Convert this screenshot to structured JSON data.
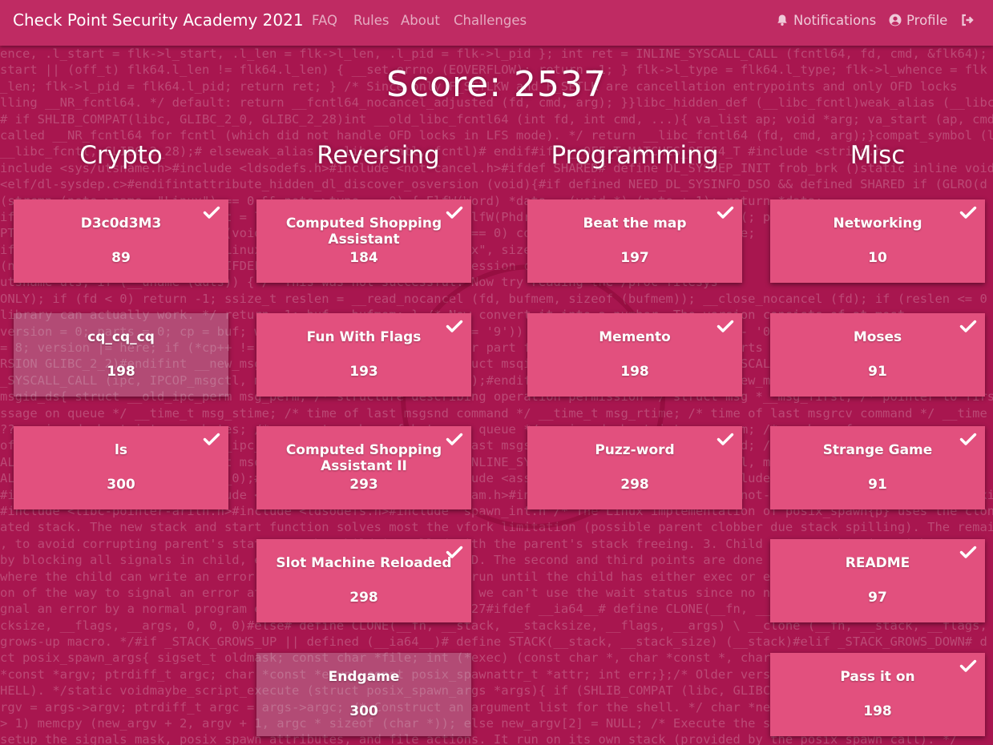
{
  "navbar": {
    "brand": "Check Point Security Academy 2021",
    "links": [
      "FAQ",
      "Rules",
      "About",
      "Challenges"
    ],
    "notifications_label": "Notifications",
    "profile_label": "Profile"
  },
  "score_text": "Score: 2537",
  "categories": [
    "Crypto",
    "Reversing",
    "Programming",
    "Misc"
  ],
  "challenges": {
    "crypto": [
      {
        "name": "D3c0d3M3",
        "points": "89",
        "solved": true
      },
      {
        "name": "cq_cq_cq",
        "points": "198",
        "solved": false
      },
      {
        "name": "ls",
        "points": "300",
        "solved": true
      }
    ],
    "reversing": [
      {
        "name": "Computed Shopping Assistant",
        "points": "184",
        "solved": true
      },
      {
        "name": "Fun With Flags",
        "points": "193",
        "solved": true
      },
      {
        "name": "Computed Shopping Assistant II",
        "points": "293",
        "solved": true
      },
      {
        "name": "Slot Machine Reloaded",
        "points": "298",
        "solved": true
      },
      {
        "name": "Endgame",
        "points": "300",
        "solved": false
      }
    ],
    "programming": [
      {
        "name": "Beat the map",
        "points": "197",
        "solved": true
      },
      {
        "name": "Memento",
        "points": "198",
        "solved": true
      },
      {
        "name": "Puzz-word",
        "points": "298",
        "solved": true
      }
    ],
    "misc": [
      {
        "name": "Networking",
        "points": "10",
        "solved": true
      },
      {
        "name": "Moses",
        "points": "91",
        "solved": true
      },
      {
        "name": "Strange Game",
        "points": "91",
        "solved": true
      },
      {
        "name": "README",
        "points": "97",
        "solved": true
      },
      {
        "name": "Pass it on",
        "points": "198",
        "solved": true
      }
    ]
  },
  "background_code": [
    "ence, .l_start = flk->l_start, .l_len = flk->l_len, .l_pid = flk->l_pid }; int ret = INLINE_SYSCALL_CALL (fcntl64, fd, cmd, &flk64);",
    "start || (off_t) flk64.l_len != flk64.l_len) { __set_errno (EOVERFLOW); return -1; } flk->l_type = flk64.l_type; flk->l_whence = flk",
    "_len; flk->l_pid = flk64.l_pid; return ret; } /* Since only F_SETLKW and F_SETLK are cancellation entrypoints and only OFD locks",
    "lling __NR_fcntl64. */ default: return __fcntl64_nocancel_adjusted (fd, cmd, arg); }}libc_hidden_def (__libc_fcntl)weak_alias (__libc",
    "# if SHLIB_COMPAT(libc, GLIBC_2_0, GLIBC_2_28)int __old_libc_fcntl64 (int fd, int cmd, ...){ va_list ap; void *arg; va_start (ap, cmd",
    "called __NR_fcntl64 for fcntl (which did not handle OFD locks in LFS mode). */ return __libc_fcntl64 (fd, cmd, arg);}compat_symbol (l",
    "__libc_fcntl, GLIBC_2_28);# elseweak_alias (__libc_fcntl, fcntl)# endif#if !__OFF_T_MATCHES_OFF64_T #include <string.h",
    "include <sys/utsname.h>#include <ldsodefs.h>#include <not-cancel.h>#ifdef SHARED# define DL_SYSDEP_INIT frob_brk ()static inline voidfr",
    "<elf/dl-sysdep.c>#endifintattribute_hidden_dl_discover_osversion (void){#if defined NEED_DL_SYSINFO_DSO && defined SHARED if (GLRO(d",
    "   (strcmp (note->name, \"Linux\") == 0 && note->type == 0) { ElfW(Word) *data = (void *) (note + 1); return *data;",
    "   ifdef SHARED { ElfW(Addr) start = l->l_map_start + l->l_phdr; ElfW(Phdr) *ph = (void *) start; for (; ph < &l->l_phdr",
    "   PT_NOTE) { ElfW(Nhdr) *note = (void *) start; if (note->n_type == 0) continue; start += sizeof *note;",
    "   if (note->n_namesz == sizeof \"Linux\" && memcmp (note + 1, \"Linux\", sizeof \"Linux\") == 0 &&",
    "   (not found) return -1; /* The IFDEF check with a __ROUND__ expression can be used with the __ROUN",
    "   utsname uts; if (__uname (&uts)) { /* This was not successful. Now try reading the /proc filesys",
    "ONLY); if (fd < 0) return -1; ssize_t reslen = __read_nocancel (fd, bufmem, sizeof (bufmem)); __close_nocancel (fd); if (reslen <= 0",
    "library can actually work. */ return -1; buf = bufmem; } /* Now convert it into a number. The version consists of at most",
    " version = 0; parts = 0; cp = buf; while ((*cp >= '0') && (*cp <= '9')) { unsigned int here = *cp++ - '0'; while (*cp",
    "= 8; version |= here; if (*cp++ != '.' || parts == 3) /* Another part following? */ break; } if (parts < 3) version <<=",
    "RSION GLIBC_2_2)#endifint __new_msgctl (int msqid, int cmd, struct msqid_ds *buf){ return INLINE_SYSCALL_CALL (msgctl, msqid,",
    "_SYSCALL_CALL (ipc, IPCOP_msgctl, msqid, cmd | __IPC_64, 0, buf);#endif}versioned_symbol (libc, __new_msgctl, msgctl, GLIBC_2",
    "msgid_ds{ struct __old_ipc_perm msg_perm; /* structure describing operation permission */ struct msg *__msg_first; /* pointer to firs",
    "ssage on queue */ __time_t msg_stime; /* time of last msgsnd command */ __time_t msg_rtime; /* time of last msgrcv command */ __time",
    "?? unsigned short int msg_cbytes; /* current number of bytes on queue */ unsigned short int msg_qnum; /* number of messages curren",
    " of bytes allowed on queue */ __ipc_pid_t msg_lspid; /* pid of last msgsnd() */ __ipc_pid_t msg_lrpid; /* pid of last msgrcv() */ }",
    "AL (msgctl, msqid, cmd, (struct msqid_ds *) buf);#else return INLINE_SYSCALL_CALL (ipc, IPCOP_msgctl, msqid, cmd, 0, buf);#endif}co",
    "AL (ipc, IPCOP_msgctl, GLIBC_2_0);#endif#include <spawn.h>#include <assert.h>#include <fcntl.h>#include <paths.h>#include <string.h",
    "   #include <sys/resource.h>#include <sys/wait.h>#include <sys/param.h>#include <sys/mman.h>#include <not-cancel.h>#include <local-setxid",
    "#include <libc-pointer-arith.h>#include <ldsodefs.h>#include \"spawn_int.h\"/* The Linux implementation of posix_spawn{p} uses the clon",
    "ated stack. The new stack and start function solves most the vfork limitation (possible parent clobber due stack spilling). The remai",
    ", to avoid corrupting parent's state. 2. The child is called with the parent's stack freeing. 3. Child must synchronize with parent",
    "by blocking all signals in child, except SIGCANCEL and SIGSETXID. The second and third points are done through a pipe, since",
    " where the child can write an error code to the parent does not run until the child has either exec or exited. */",
    "on of the way to signal an error at the child: since vfork wait we can't use the wait status since no new wait status was wanted t",
    "gnal an error by a normal program exit. */#define SPAWN_ERROR 127#ifdef __ia64__# define CLONE(__fn, __stack, __stacksize,",
    "cksize, __flags, __args, 0, 0, 0)#else# define CLONE(__fn, __stack, __stacksize, __flags, __args) \\ __clone (__fn, __stack, __flags,",
    " grows-up macro. */#if _STACK_GROWS_UP || defined (__ia64__)# define STACK(__stack, __stack_size) (__stack)#elif _STACK_GROWS_DOWN# d",
    "ct posix_spawn_args{ sigset_t oldmask; const char *file; int (*exec) (const char *, char *const *, char *const",
    "   *const *argv; ptrdiff_t argc; char *const *envp; const posix_spawnattr_t *attr; int err;};/* Older version requires t",
    "HELL). */static voidmaybe_script_execute (struct posix_spawn_args *args){ if (SHLIB_COMPAT (libc, GLIBC_2_2, GLIBC_2_15) &&",
    "rgv = args->argv; ptrdiff_t argc = args->argc; /* Construct an argument list for the shell. */ char *new_argv[argc + 2];",
    " > 1) memcpy (new_argv + 2, argv + 1, argc * sizeof (char *)); else new_argv[2] = NULL; /* Execute the shell. */",
    "setup the signals mask, posix spawn attributes, and file actions. It run on its own stack (provided by the posix_spawn call). */"
  ]
}
